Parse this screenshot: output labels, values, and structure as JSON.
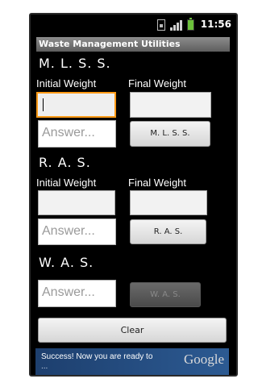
{
  "status_bar": {
    "time": "11:56"
  },
  "app": {
    "title": "Waste Management Utilities"
  },
  "sections": [
    {
      "heading": "M. L. S. S.",
      "initial_label": "Initial Weight",
      "final_label": "Final Weight",
      "initial_value": "",
      "final_value": "",
      "answer_placeholder": "Answer...",
      "button_label": "M. L. S. S.",
      "button_enabled": true
    },
    {
      "heading": "R. A. S.",
      "initial_label": "Initial Weight",
      "final_label": "Final Weight",
      "initial_value": "",
      "final_value": "",
      "answer_placeholder": "Answer...",
      "button_label": "R. A. S.",
      "button_enabled": true
    },
    {
      "heading": "W. A. S.",
      "answer_placeholder": "Answer...",
      "button_label": "W. A. S.",
      "button_enabled": false
    }
  ],
  "clear_button": {
    "label": "Clear"
  },
  "ad_banner": {
    "line1": "Success! Now you are ready to",
    "line2": "...",
    "brand": "Google"
  },
  "colors": {
    "screen_background": "#000000",
    "focus_border": "#ff9a16",
    "title_bar": "#6e6e6e"
  }
}
